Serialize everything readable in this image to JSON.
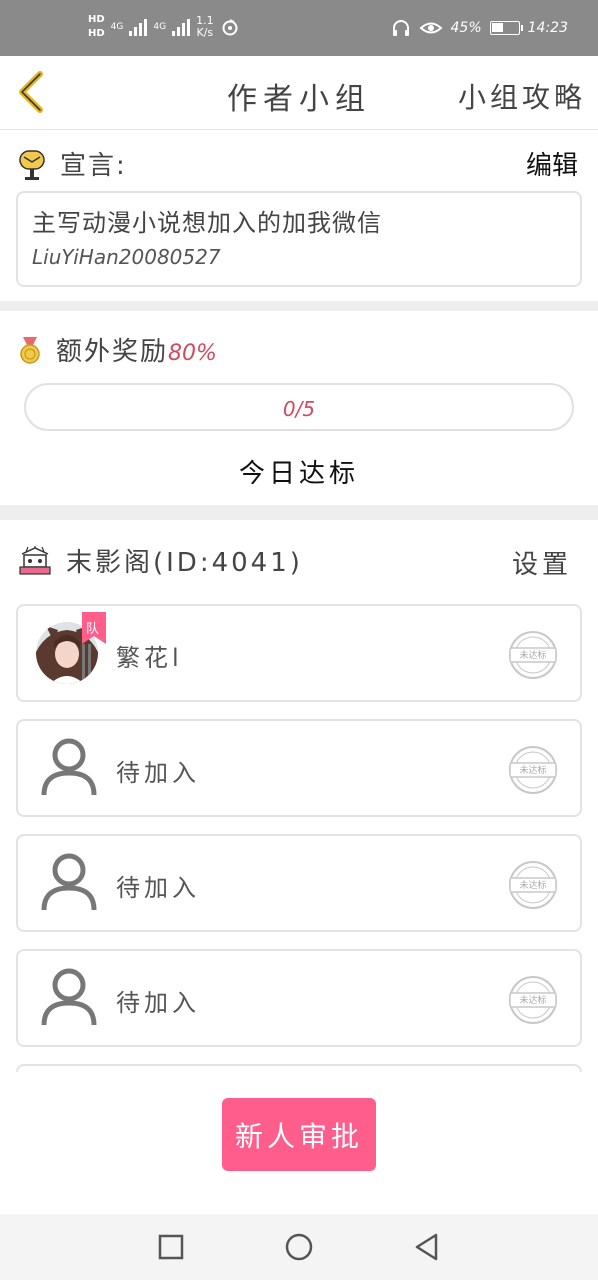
{
  "status_bar": {
    "hd1": "HD",
    "hd2": "HD",
    "net1": "4G",
    "net2": "4G",
    "speed_value": "1.1",
    "speed_unit": "K/s",
    "battery": "45%",
    "battery_level": 0.45,
    "time": "14:23"
  },
  "header": {
    "title": "作者小组",
    "guide_label": "小组攻略"
  },
  "manifesto": {
    "label": "宣言:",
    "edit_label": "编辑",
    "text": "主写动漫小说想加入的加我微信",
    "wechat": "LiuYiHan20080527"
  },
  "reward": {
    "label": "额外奖励",
    "percent": "80%",
    "progress_text": "0/5",
    "progress_fraction": 0,
    "today_label": "今日达标"
  },
  "group": {
    "name": "末影阁(ID:4041)",
    "settings_label": "设置",
    "members": [
      {
        "name": "繁花l",
        "badge": "队",
        "status": "未达标"
      },
      {
        "name": "待加入",
        "status": "未达标"
      },
      {
        "name": "待加入",
        "status": "未达标"
      },
      {
        "name": "待加入",
        "status": "未达标"
      }
    ]
  },
  "approve_button": "新人审批",
  "colors": {
    "accent": "#ff5d8c",
    "reward_red": "#d24a5f",
    "back_arrow": "#e3b21c",
    "status_bar": "#8a8a8a"
  }
}
